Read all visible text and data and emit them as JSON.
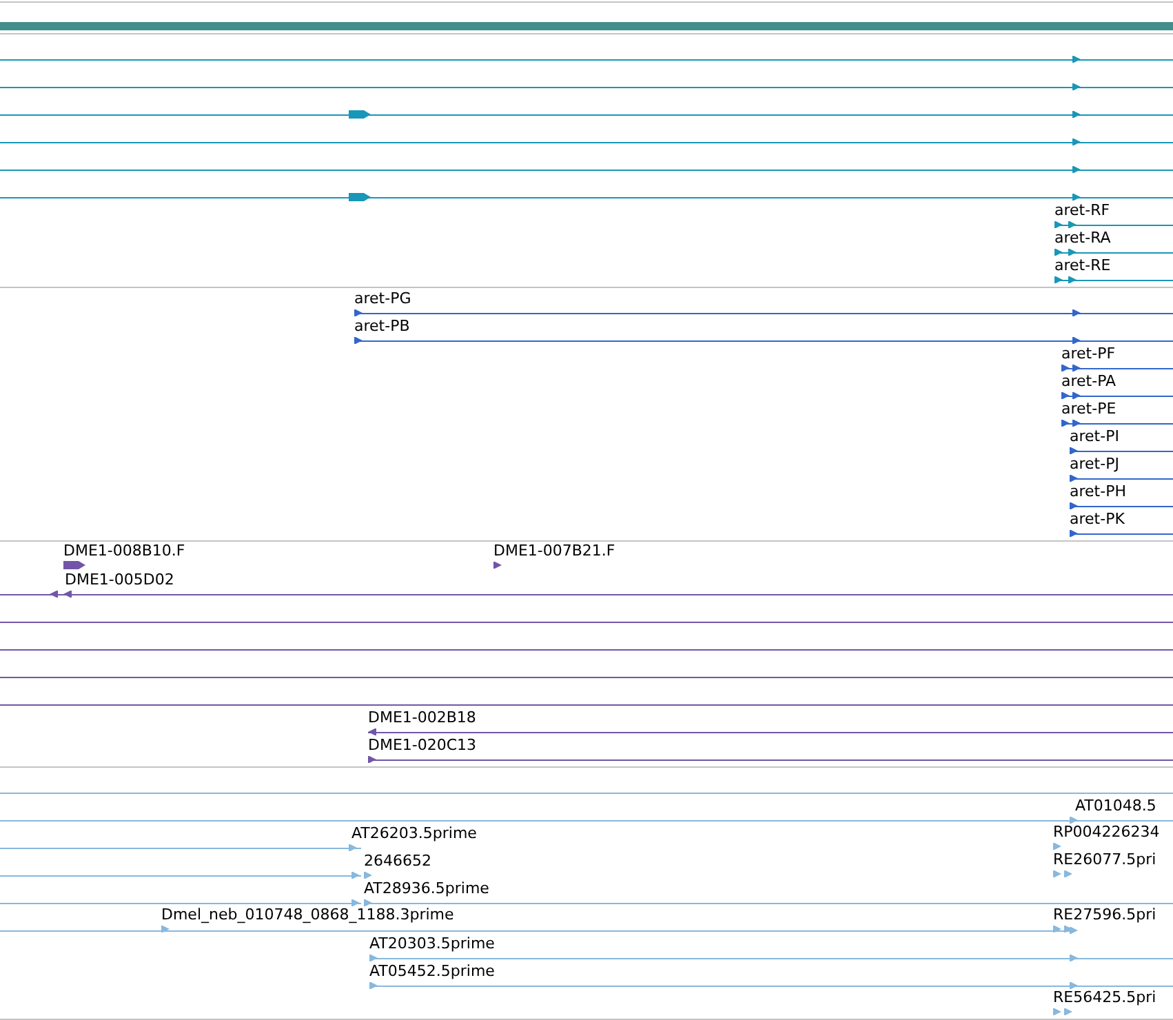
{
  "tracks": [
    {
      "features": [
        {
          "label": "aret-RF",
          "reverse": false
        },
        {
          "label": "aret-RA",
          "reverse": false
        },
        {
          "label": "aret-RE",
          "reverse": false
        }
      ]
    },
    {
      "features": [
        {
          "label": "aret-PG",
          "reverse": false
        },
        {
          "label": "aret-PB",
          "reverse": false
        },
        {
          "label": "aret-PF",
          "reverse": false
        },
        {
          "label": "aret-PA",
          "reverse": false
        },
        {
          "label": "aret-PE",
          "reverse": false
        },
        {
          "label": "aret-PI",
          "reverse": false
        },
        {
          "label": "aret-PJ",
          "reverse": false
        },
        {
          "label": "aret-PH",
          "reverse": false
        },
        {
          "label": "aret-PK",
          "reverse": false
        }
      ]
    },
    {
      "features": [
        {
          "label": "DME1-008B10.F",
          "reverse": false
        },
        {
          "label": "DME1-007B21.F",
          "reverse": false
        },
        {
          "label": "DME1-005D02",
          "reverse": true
        },
        {
          "label": "DME1-002B18",
          "reverse": true
        },
        {
          "label": "DME1-020C13",
          "reverse": false
        }
      ]
    },
    {
      "features": [
        {
          "label": "AT01048.5",
          "reverse": false
        },
        {
          "label": "AT26203.5prime",
          "reverse": false
        },
        {
          "label": "RP004226234",
          "reverse": false
        },
        {
          "label": "2646652",
          "reverse": false
        },
        {
          "label": "RE26077.5pri",
          "reverse": false
        },
        {
          "label": "AT28936.5prime",
          "reverse": false
        },
        {
          "label": "Dmel_neb_010748_0868_1188.3prime",
          "reverse": false
        },
        {
          "label": "RE27596.5pri",
          "reverse": false
        },
        {
          "label": "AT20303.5prime",
          "reverse": false
        },
        {
          "label": "AT05452.5prime",
          "reverse": false
        },
        {
          "label": "RE56425.5pri",
          "reverse": false
        }
      ]
    }
  ]
}
